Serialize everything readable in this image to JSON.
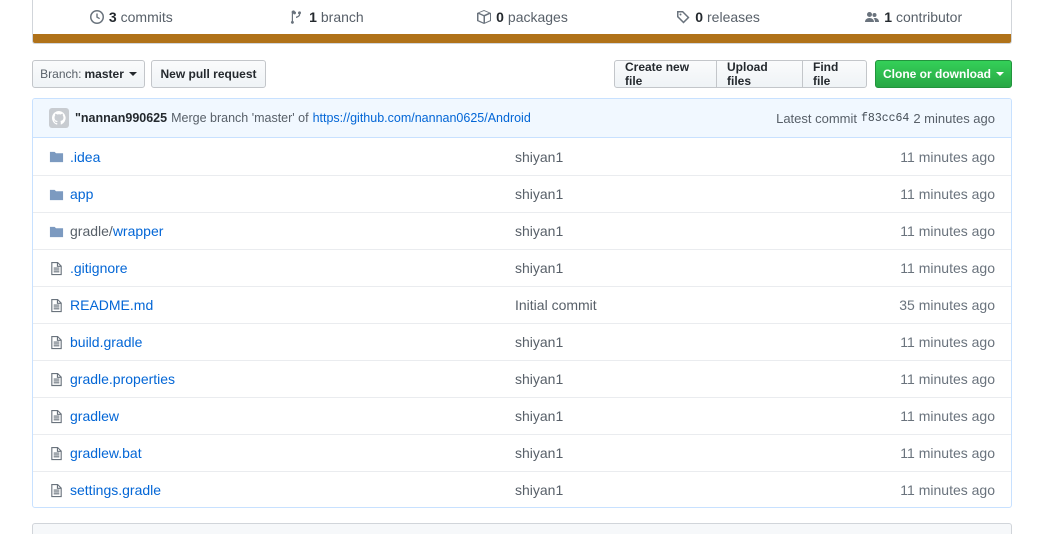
{
  "summary": {
    "commits": {
      "count": "3",
      "label": "commits"
    },
    "branches": {
      "count": "1",
      "label": "branch"
    },
    "packages": {
      "count": "0",
      "label": "packages"
    },
    "releases": {
      "count": "0",
      "label": "releases"
    },
    "contributors": {
      "count": "1",
      "label": "contributor"
    },
    "language_color": "#b07219"
  },
  "toolbar": {
    "branch_prefix": "Branch:",
    "branch_name": "master",
    "new_pull_request": "New pull request",
    "create_new_file": "Create new file",
    "upload_files": "Upload files",
    "find_file": "Find file",
    "clone_or_download": "Clone or download"
  },
  "commit": {
    "author": "\"nannan990625",
    "message": "Merge branch 'master' of",
    "link": "https://github.com/nannan0625/Android",
    "latest_label": "Latest commit",
    "sha": "f83cc64",
    "age": "2 minutes ago"
  },
  "files": [
    {
      "type": "dir",
      "name": ".idea",
      "message": "shiyan1",
      "age": "11 minutes ago"
    },
    {
      "type": "dir",
      "name": "app",
      "message": "shiyan1",
      "age": "11 minutes ago"
    },
    {
      "type": "dir",
      "dir": "gradle/",
      "name": "wrapper",
      "message": "shiyan1",
      "age": "11 minutes ago"
    },
    {
      "type": "file",
      "name": ".gitignore",
      "message": "shiyan1",
      "age": "11 minutes ago"
    },
    {
      "type": "file",
      "name": "README.md",
      "message": "Initial commit",
      "age": "35 minutes ago"
    },
    {
      "type": "file",
      "name": "build.gradle",
      "message": "shiyan1",
      "age": "11 minutes ago"
    },
    {
      "type": "file",
      "name": "gradle.properties",
      "message": "shiyan1",
      "age": "11 minutes ago"
    },
    {
      "type": "file",
      "name": "gradlew",
      "message": "shiyan1",
      "age": "11 minutes ago"
    },
    {
      "type": "file",
      "name": "gradlew.bat",
      "message": "shiyan1",
      "age": "11 minutes ago"
    },
    {
      "type": "file",
      "name": "settings.gradle",
      "message": "shiyan1",
      "age": "11 minutes ago"
    }
  ]
}
